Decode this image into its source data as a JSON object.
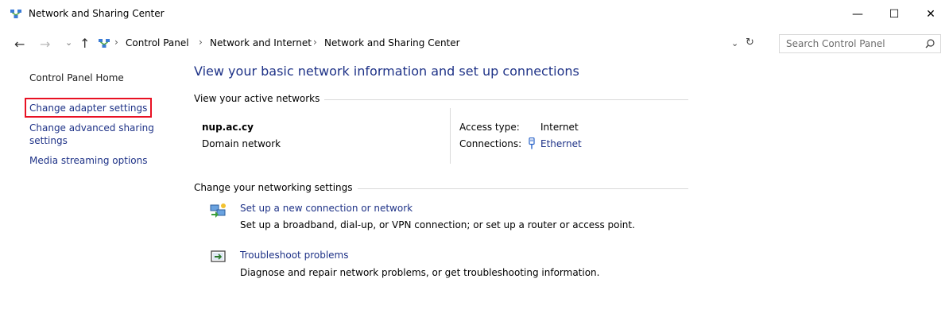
{
  "window": {
    "title": "Network and Sharing Center",
    "minimize_glyph": "—",
    "maximize_glyph": "☐",
    "close_glyph": "✕"
  },
  "nav": {
    "back_glyph": "←",
    "forward_glyph": "→",
    "recent_glyph": "⌄",
    "up_glyph": "↑"
  },
  "address_bar": {
    "separator": "›",
    "breadcrumbs": [
      "Control Panel",
      "Network and Internet",
      "Network and Sharing Center"
    ],
    "dropdown_glyph": "⌄",
    "refresh_glyph": "↻"
  },
  "search": {
    "placeholder": "Search Control Panel",
    "icon": "search-icon"
  },
  "left_nav": {
    "home": "Control Panel Home",
    "links": [
      "Change adapter settings",
      "Change advanced sharing",
      "settings",
      "Media streaming options"
    ],
    "highlighted_item": "Change adapter settings",
    "highlight_color": "#e81123"
  },
  "main": {
    "heading": "View your basic network information and set up connections",
    "active_networks_label": "View your active networks",
    "network": {
      "name": "nup.ac.cy",
      "type": "Domain network",
      "access_type_label": "Access type:",
      "access_type_value": "Internet",
      "connections_label": "Connections:",
      "connections_value": "Ethernet"
    },
    "change_settings_label": "Change your networking settings",
    "tasks": [
      {
        "icon": "new-connection-icon",
        "link": "Set up a new connection or network",
        "description": "Set up a broadband, dial-up, or VPN connection; or set up a router or access point."
      },
      {
        "icon": "troubleshoot-icon",
        "link": "Troubleshoot problems",
        "description": "Diagnose and repair network problems, or get troubleshooting information."
      }
    ]
  },
  "colors": {
    "link": "#1e3287",
    "heading": "#1e3287",
    "divider": "#d9d9d9",
    "highlight": "#e81123"
  }
}
